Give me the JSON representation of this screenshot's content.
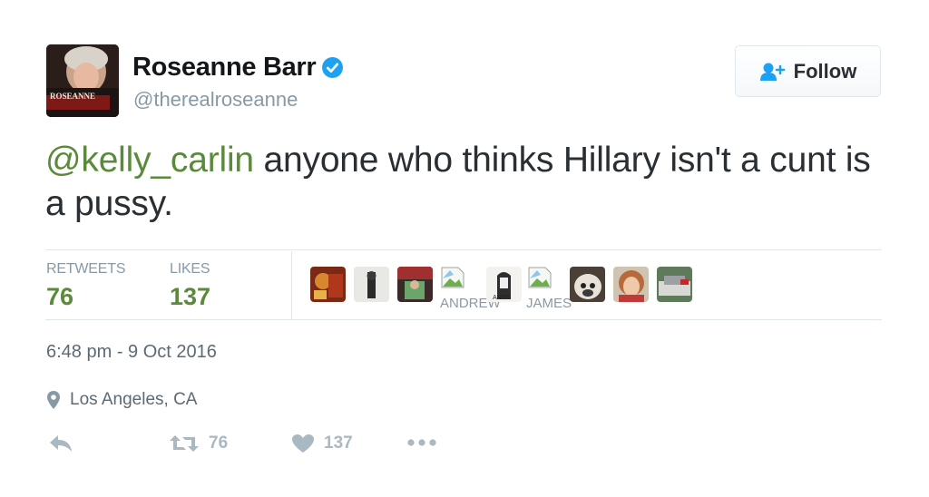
{
  "user": {
    "name": "Roseanne Barr",
    "handle": "@therealroseanne",
    "avatar_caption": "ROSEANNE"
  },
  "follow_label": "Follow",
  "tweet": {
    "mention": "@kelly_carlin",
    "text": " anyone who thinks Hillary isn't a cunt is a pussy."
  },
  "stats": {
    "retweets_label": "RETWEETS",
    "retweets_value": "76",
    "likes_label": "LIKES",
    "likes_value": "137"
  },
  "likers": {
    "broken_labels": [
      "ANDREW",
      "JAMES"
    ]
  },
  "timestamp": "6:48 pm - 9 Oct 2016",
  "location": "Los Angeles, CA",
  "actions": {
    "retweet_count": "76",
    "like_count": "137"
  },
  "colors": {
    "accent_green": "#5a8a3a",
    "muted": "#8899a6",
    "verified_blue": "#1da1f2"
  }
}
